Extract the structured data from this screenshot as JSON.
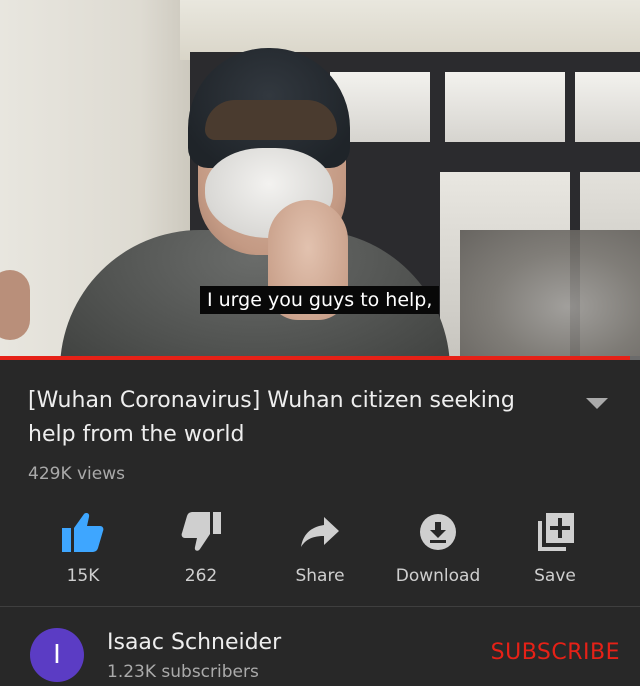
{
  "video": {
    "caption": "I urge you guys to help,",
    "progress_fraction": 0.985
  },
  "details": {
    "title": "[Wuhan Coronavirus] Wuhan citizen seeking help from the world",
    "views": "429K views",
    "expand_icon": "chevron-down-icon"
  },
  "actions": {
    "like": {
      "label": "15K",
      "icon": "thumbs-up-icon",
      "active": true
    },
    "dislike": {
      "label": "262",
      "icon": "thumbs-down-icon"
    },
    "share": {
      "label": "Share",
      "icon": "share-arrow-icon"
    },
    "download": {
      "label": "Download",
      "icon": "download-icon"
    },
    "save": {
      "label": "Save",
      "icon": "add-to-playlist-icon"
    }
  },
  "channel": {
    "avatar_letter": "I",
    "name": "Isaac Schneider",
    "subscribers": "1.23K subscribers",
    "subscribe_label": "SUBSCRIBE"
  },
  "colors": {
    "background": "#282828",
    "accent_red": "#e62117",
    "like_blue": "#3ea6ff",
    "avatar_purple": "#5b3cc4"
  }
}
